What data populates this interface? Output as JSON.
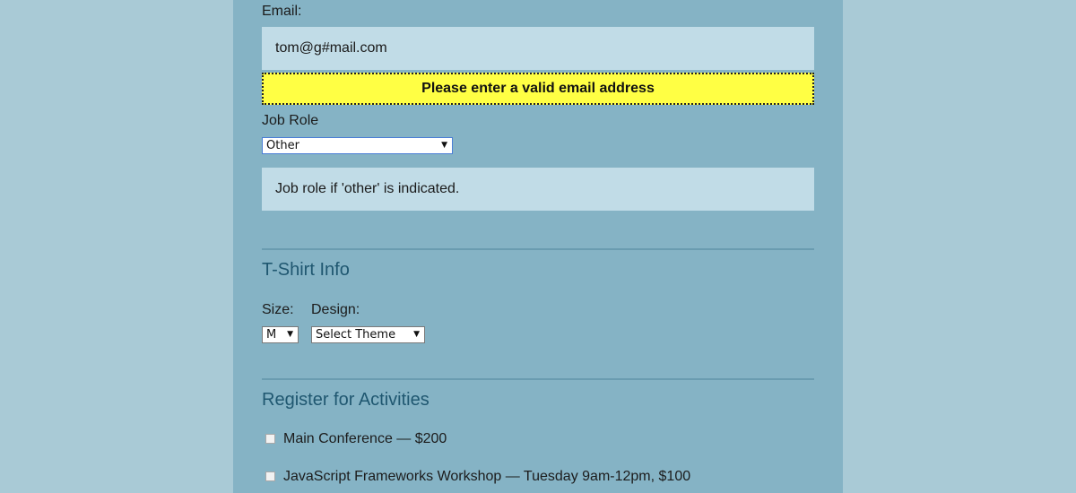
{
  "email": {
    "label": "Email:",
    "value": "tom@g#mail.com",
    "error": "Please enter a valid email address"
  },
  "job_role": {
    "label": "Job Role",
    "selected": "Other",
    "other_placeholder": "Job role if 'other' is indicated."
  },
  "tshirt": {
    "title": "T-Shirt Info",
    "size_label": "Size:",
    "size_selected": "M",
    "design_label": "Design:",
    "design_selected": "Select Theme"
  },
  "activities": {
    "title": "Register for Activities",
    "items": [
      {
        "label": "Main Conference — $200",
        "checked": false
      },
      {
        "label": "JavaScript Frameworks Workshop — Tuesday 9am-12pm, $100",
        "checked": false
      }
    ]
  }
}
